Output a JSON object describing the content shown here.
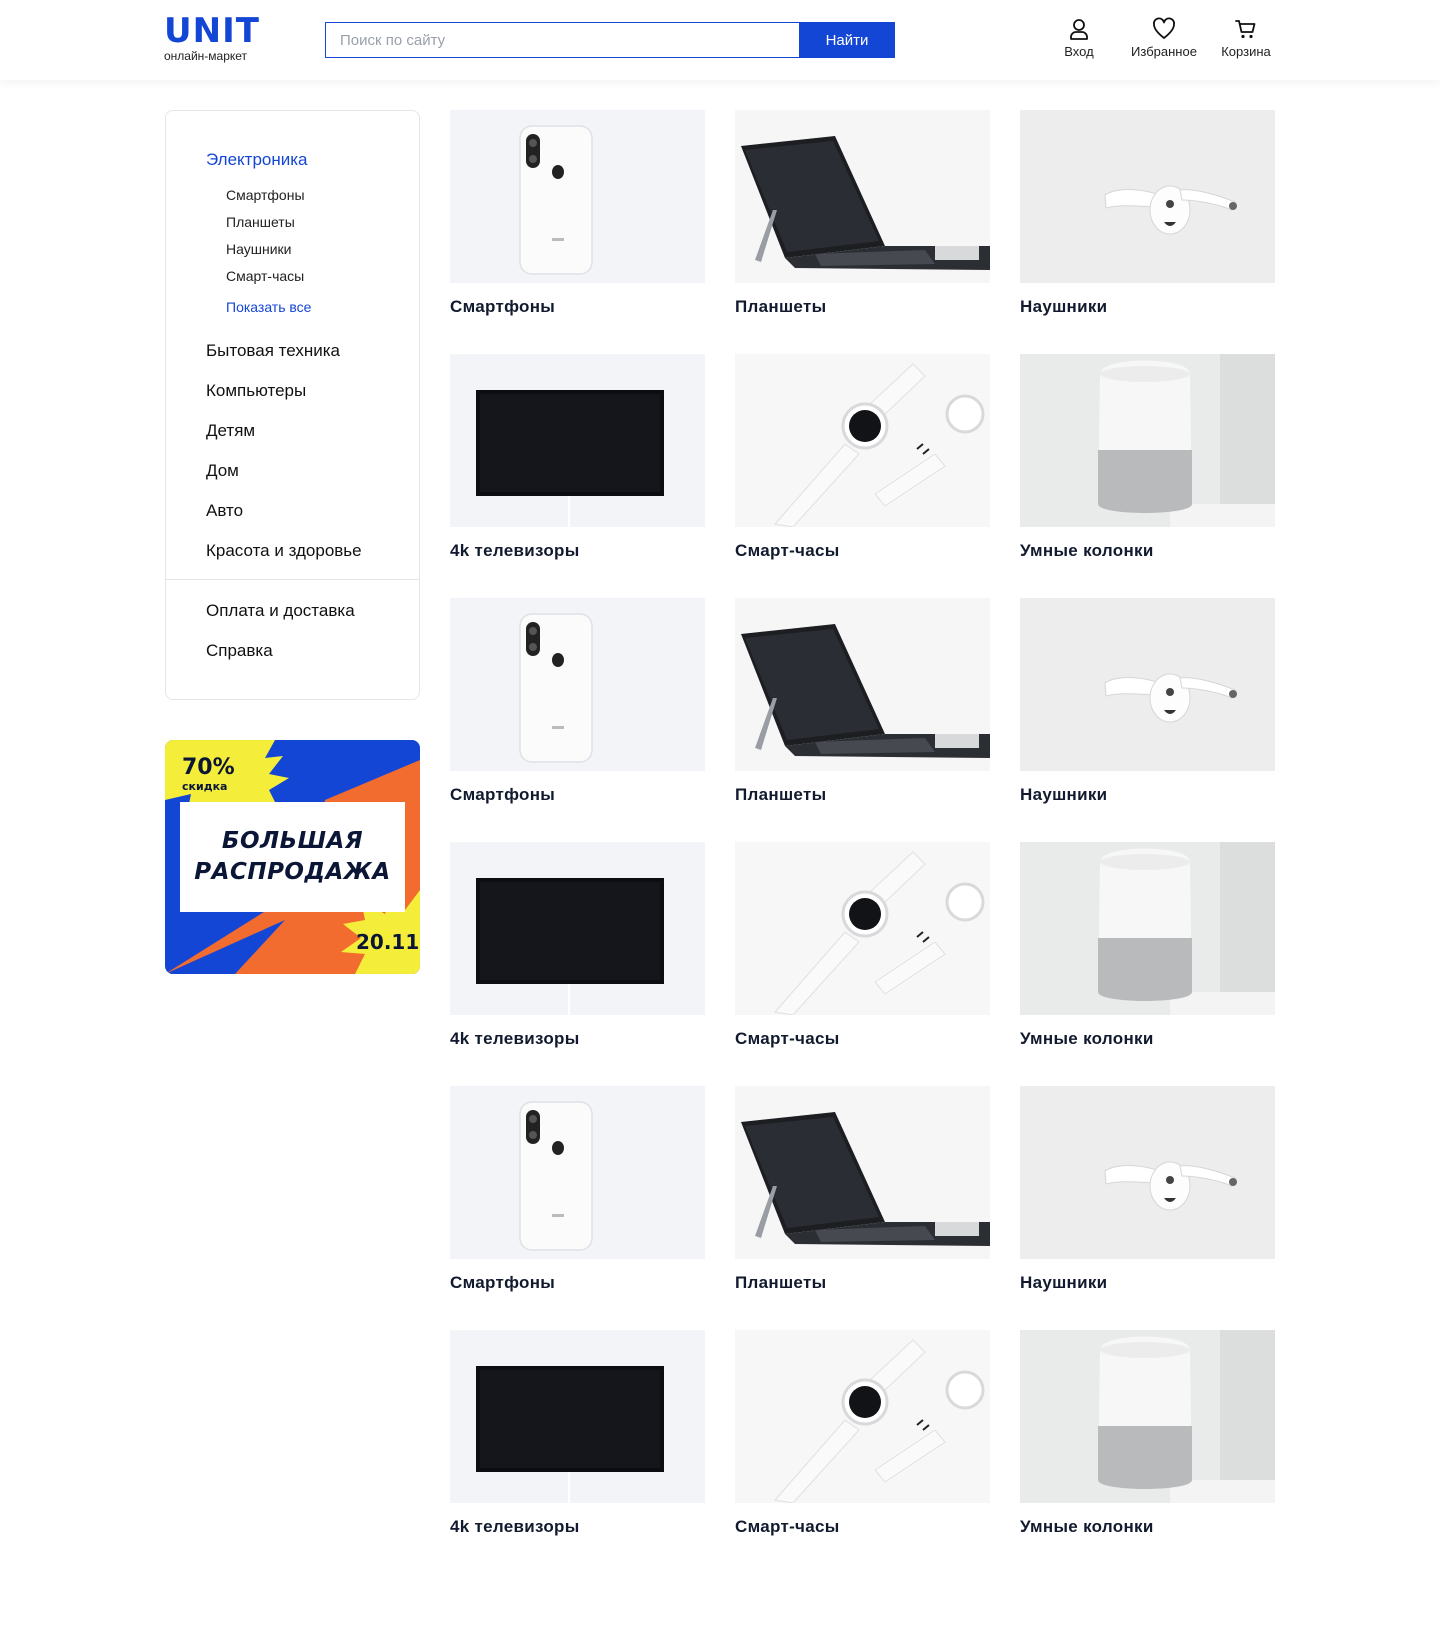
{
  "header": {
    "logo": {
      "title": "UNIT",
      "subtitle": "онлайн-маркет"
    },
    "search": {
      "placeholder": "Поиск по сайту",
      "value": "",
      "button_label": "Найти"
    },
    "actions": [
      {
        "label": "Вход",
        "icon": "user-icon"
      },
      {
        "label": "Избранное",
        "icon": "heart-icon"
      },
      {
        "label": "Корзина",
        "icon": "cart-icon"
      }
    ]
  },
  "sidebar": {
    "active_category": "Электроника",
    "subcategories": [
      "Смартфоны",
      "Планшеты",
      "Наушники",
      "Смарт-часы"
    ],
    "show_all": "Показать все",
    "categories": [
      "Бытовая техника",
      "Компьютеры",
      "Детям",
      "Дом",
      "Авто",
      "Красота и здоровье"
    ],
    "links": [
      "Оплата и доставка",
      "Справка"
    ]
  },
  "promo": {
    "percent": "70%",
    "percent_sub": "скидка",
    "title_line1": "БОЛЬШАЯ",
    "title_line2": "РАСПРОДАЖА",
    "date": "20.11",
    "colors": {
      "blue": "#1446d6",
      "orange": "#f26b2f",
      "yellow": "#f4ee3a",
      "navy": "#0b1636"
    }
  },
  "products": [
    {
      "title": "Смартфоны",
      "image": "smartphone"
    },
    {
      "title": "Планшеты",
      "image": "tablet"
    },
    {
      "title": "Наушники",
      "image": "earbuds"
    },
    {
      "title": "4k телевизоры",
      "image": "tv"
    },
    {
      "title": "Смарт-часы",
      "image": "watch"
    },
    {
      "title": "Умные колонки",
      "image": "speaker"
    },
    {
      "title": "Смартфоны",
      "image": "smartphone"
    },
    {
      "title": "Планшеты",
      "image": "tablet"
    },
    {
      "title": "Наушники",
      "image": "earbuds"
    },
    {
      "title": "4k телевизоры",
      "image": "tv"
    },
    {
      "title": "Смарт-часы",
      "image": "watch"
    },
    {
      "title": "Умные колонки",
      "image": "speaker"
    },
    {
      "title": "Смартфоны",
      "image": "smartphone"
    },
    {
      "title": "Планшеты",
      "image": "tablet"
    },
    {
      "title": "Наушники",
      "image": "earbuds"
    },
    {
      "title": "4k телевизоры",
      "image": "tv"
    },
    {
      "title": "Смарт-часы",
      "image": "watch"
    },
    {
      "title": "Умные колонки",
      "image": "speaker"
    }
  ],
  "colors": {
    "accent": "#1446d6",
    "text": "#111a2e",
    "border": "#e3e5ea"
  }
}
